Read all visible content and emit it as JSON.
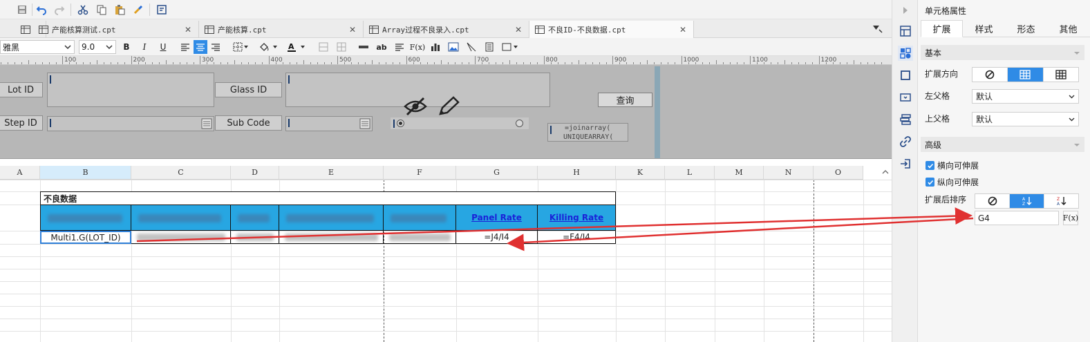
{
  "tabs": [
    {
      "label": "产能核算测试.cpt",
      "active": false
    },
    {
      "label": "产能核算.cpt",
      "active": false
    },
    {
      "label": "Array过程不良录入.cpt",
      "active": false
    },
    {
      "label": "不良ID-不良数据.cpt",
      "active": true
    }
  ],
  "format_toolbar": {
    "font_name": "雅黑",
    "font_size": "9.0"
  },
  "ruler_labels": [
    "100",
    "200",
    "300",
    "400",
    "500",
    "600",
    "700",
    "800",
    "900",
    "1000",
    "1100",
    "1200"
  ],
  "parameters": {
    "lot_id_label": "Lot ID",
    "glass_id_label": "Glass ID",
    "step_id_label": "Step ID",
    "sub_code_label": "Sub Code",
    "query_button": "查询",
    "formula_line1": "=joinarray(",
    "formula_line2": "UNIQUEARRAY("
  },
  "columns": [
    "A",
    "B",
    "C",
    "D",
    "E",
    "F",
    "G",
    "H",
    "K",
    "L",
    "M",
    "N",
    "O"
  ],
  "sheet": {
    "title": "不良数据",
    "header_panel_rate": "Panel Rate",
    "header_killing_rate": "Killing Rate",
    "data_b4": "Multi1.G(LOT_ID)",
    "data_g4": "=J4/I4",
    "data_h4": "=F4/I4"
  },
  "panel": {
    "title": "单元格属性",
    "tabs": [
      "扩展",
      "样式",
      "形态",
      "其他"
    ],
    "basic_section": "基本",
    "expand_direction_label": "扩展方向",
    "left_parent_label": "左父格",
    "left_parent_value": "默认",
    "top_parent_label": "上父格",
    "top_parent_value": "默认",
    "advanced_section": "高级",
    "horizontal_expand_label": "横向可伸展",
    "vertical_expand_label": "纵向可伸展",
    "sort_after_expand_label": "扩展后排序",
    "sort_formula_value": "G4",
    "fx_label": "F(x)"
  },
  "colors": {
    "accent": "#2f8be6",
    "header_fill": "#27a6e2",
    "annotation_arrow": "#e03030",
    "link_text": "#1a22d8"
  }
}
